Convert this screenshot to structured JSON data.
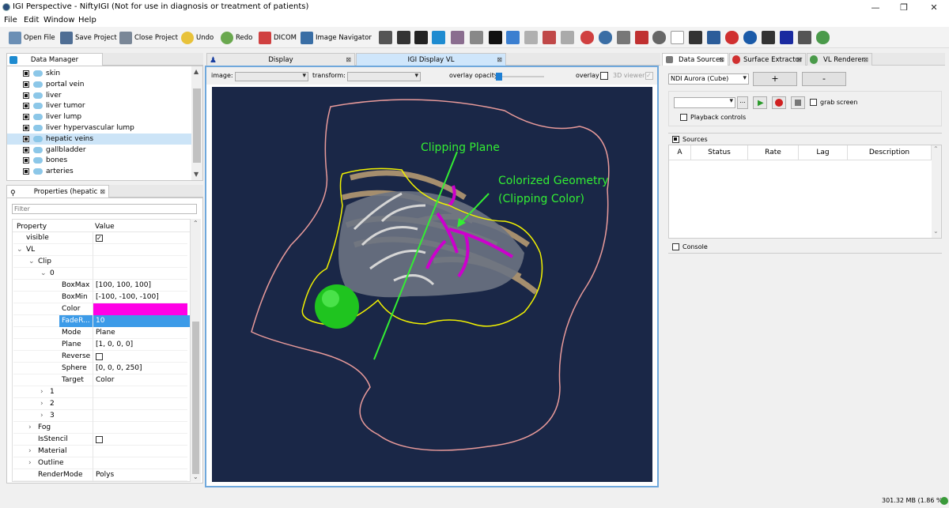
{
  "window": {
    "title": "IGI Perspective - NiftyIGI (Not for use in diagnosis or treatment of patients)",
    "controls": [
      "—",
      "❐",
      "✕"
    ]
  },
  "menu": [
    "File",
    "Edit",
    "Window",
    "Help"
  ],
  "toolbar": {
    "open_file": "Open File",
    "save_project": "Save Project",
    "close_project": "Close Project",
    "undo": "Undo",
    "redo": "Redo",
    "dicom": "DICOM",
    "image_navigator": "Image Navigator"
  },
  "data_manager": {
    "tab_label": "Data Manager",
    "items": [
      {
        "label": "skin"
      },
      {
        "label": "portal vein"
      },
      {
        "label": "liver"
      },
      {
        "label": "liver tumor"
      },
      {
        "label": "liver lump"
      },
      {
        "label": "liver hypervascular lump"
      },
      {
        "label": "hepatic veins",
        "selected": true
      },
      {
        "label": "gallbladder"
      },
      {
        "label": "bones"
      },
      {
        "label": "arteries"
      }
    ]
  },
  "properties": {
    "tab_label": "Properties (hepatic veins)",
    "filter_placeholder": "Filter",
    "headers": {
      "property": "Property",
      "value": "Value"
    },
    "rows": [
      {
        "indent": 0,
        "arrow": "",
        "name": "visible",
        "value": "",
        "checkbox": "checked"
      },
      {
        "indent": 0,
        "arrow": "⌄",
        "name": "VL",
        "value": ""
      },
      {
        "indent": 1,
        "arrow": "⌄",
        "name": "Clip",
        "value": ""
      },
      {
        "indent": 2,
        "arrow": "⌄",
        "name": "0",
        "value": ""
      },
      {
        "indent": 3,
        "arrow": "",
        "name": "BoxMax",
        "value": "[100, 100, 100]"
      },
      {
        "indent": 3,
        "arrow": "",
        "name": "BoxMin",
        "value": "[-100, -100, -100]"
      },
      {
        "indent": 3,
        "arrow": "",
        "name": "Color",
        "value": "",
        "swatch": "#ff00e6"
      },
      {
        "indent": 3,
        "arrow": "",
        "name": "FadeR...",
        "value": "10",
        "selected": true
      },
      {
        "indent": 3,
        "arrow": "",
        "name": "Mode",
        "value": "Plane"
      },
      {
        "indent": 3,
        "arrow": "",
        "name": "Plane",
        "value": "[1, 0, 0, 0]"
      },
      {
        "indent": 3,
        "arrow": "",
        "name": "Reverse",
        "value": "",
        "checkbox": "unchecked"
      },
      {
        "indent": 3,
        "arrow": "",
        "name": "Sphere",
        "value": "[0, 0, 0, 250]"
      },
      {
        "indent": 3,
        "arrow": "",
        "name": "Target",
        "value": "Color"
      },
      {
        "indent": 2,
        "arrow": "›",
        "name": "1",
        "value": ""
      },
      {
        "indent": 2,
        "arrow": "›",
        "name": "2",
        "value": ""
      },
      {
        "indent": 2,
        "arrow": "›",
        "name": "3",
        "value": ""
      },
      {
        "indent": 1,
        "arrow": "›",
        "name": "Fog",
        "value": ""
      },
      {
        "indent": 1,
        "arrow": "",
        "name": "IsStencil",
        "value": "",
        "checkbox": "unchecked"
      },
      {
        "indent": 1,
        "arrow": "›",
        "name": "Material",
        "value": ""
      },
      {
        "indent": 1,
        "arrow": "›",
        "name": "Outline",
        "value": ""
      },
      {
        "indent": 1,
        "arrow": "",
        "name": "RenderMode",
        "value": "Polys"
      }
    ]
  },
  "editor": {
    "tabs": [
      "Display",
      "IGI Display VL"
    ],
    "image_label": "image:",
    "transform_label": "transform:",
    "overlay_opacity_label": "overlay opacity",
    "overlay_opacity": 0.05,
    "overlay_label": "overlay",
    "viewer_3d_label": "3D viewer",
    "annotations": {
      "clipping_plane": "Clipping Plane",
      "colorized_line1": "Colorized Geometry",
      "colorized_line2": "(Clipping Color)"
    },
    "colors": {
      "background": "#1a2747",
      "annotation": "#33ee33",
      "clip_color": "#cc00cc",
      "skin_outline": "#e89a9a",
      "liver_outline": "#f2f200"
    }
  },
  "right_panel": {
    "tabs": [
      "Data Sources",
      "Surface Extractor",
      "VL Renderer"
    ],
    "source_combo": "NDI Aurora (Cube)",
    "add_btn": "+",
    "remove_btn": "-",
    "ellipsis_btn": "...",
    "grab_screen": "grab screen",
    "playback_controls": "Playback controls",
    "sources_label": "Sources",
    "columns": [
      "A",
      "Status",
      "Rate",
      "Lag",
      "Description"
    ],
    "console_label": "Console"
  },
  "statusbar": {
    "memory": "301.32 MB (1.86 %)"
  }
}
